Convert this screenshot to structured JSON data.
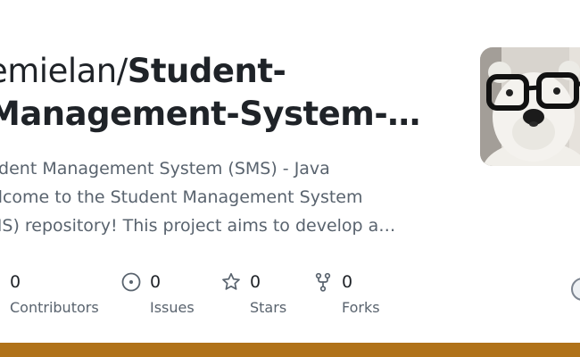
{
  "repo": {
    "owner": "emielan/",
    "name_line1": "Student-",
    "name_line2": "Management-System-…",
    "description_lines": [
      "udent Management System (SMS) - Java",
      "elcome to the Student Management System",
      "MS) repository! This project aims to develop a…"
    ]
  },
  "stats": [
    {
      "icon": "people-icon",
      "value": "0",
      "label": "Contributors"
    },
    {
      "icon": "issue-icon",
      "value": "0",
      "label": "Issues"
    },
    {
      "icon": "star-icon",
      "value": "0",
      "label": "Stars"
    },
    {
      "icon": "fork-icon",
      "value": "0",
      "label": "Forks"
    }
  ],
  "colors": {
    "language_bar": "#b07219",
    "muted_text": "#59636e",
    "primary_text": "#1f2328"
  }
}
